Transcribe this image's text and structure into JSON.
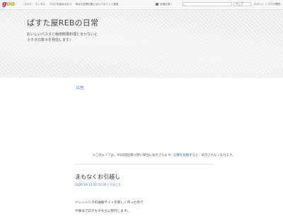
{
  "topbar": {
    "logo": {
      "g": "g",
      "o1": "o",
      "o2": "o"
    },
    "nav_items": [
      "ブログ",
      "ランダム",
      "ブログを始めるなら",
      "毎月の訪問日数に応じてポイント進呈"
    ],
    "register_label": "記事を書く",
    "search_placeholder": "",
    "search_scope": "ウェブ",
    "login_label": "ログイン",
    "blog_start_label": "ブログ開設"
  },
  "header": {
    "title": "ぱすた屋REBの日常",
    "description": [
      "おいしいパスタと飯田飲風料理とまかないと",
      "小ネタの数々を発信します♪"
    ]
  },
  "ad": {
    "label": "広告",
    "note_prefix": "※このエリアは、90日間投稿が無い場合に表示されます。",
    "note_link": "記事を投稿",
    "note_suffix": "すると、表示されなくなります。"
  },
  "entry": {
    "title": "まもなくお引越し",
    "date": "2020-10-13 22:50:30",
    "category": "できごと",
    "body": [
      "ドレッシングの通販サイトを新しく作ったので",
      "今後はブログもそちらに移行します。"
    ]
  }
}
